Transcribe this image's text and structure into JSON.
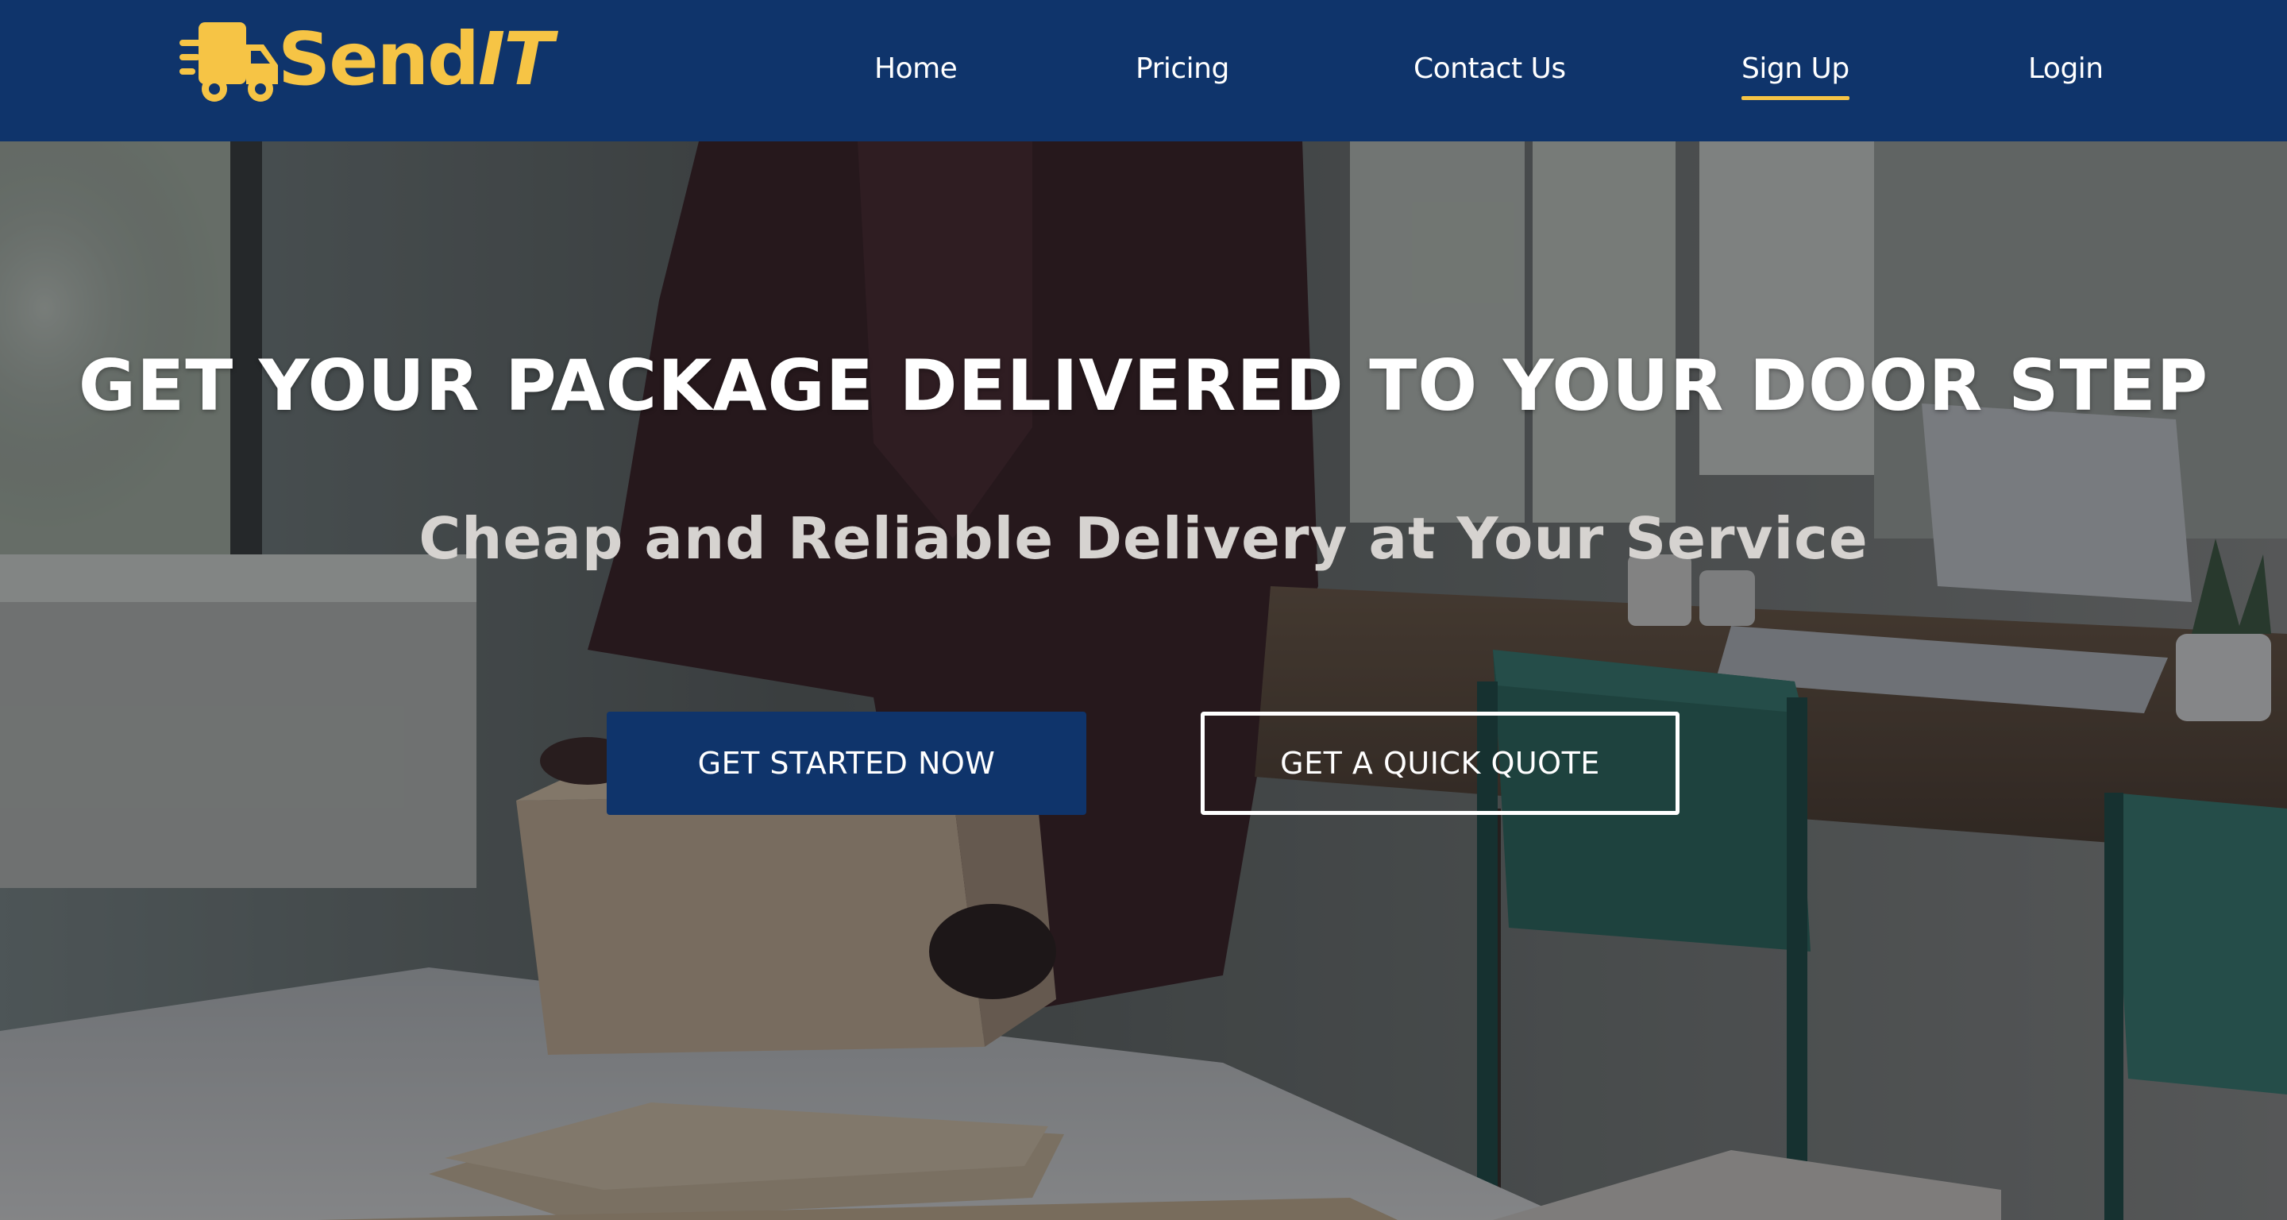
{
  "brand": {
    "name_main": "Send",
    "name_accent": "IT",
    "icon": "delivery-truck-icon",
    "color": "#f6c445"
  },
  "nav": {
    "background": "#0f346b",
    "items": [
      {
        "label": "Home"
      },
      {
        "label": "Pricing"
      },
      {
        "label": "Contact Us"
      },
      {
        "label": "Sign Up",
        "active": true
      },
      {
        "label": "Login"
      }
    ]
  },
  "hero": {
    "headline": "GET YOUR PACKAGE DELIVERED TO YOUR DOOR STEP",
    "subheadline": "Cheap and Reliable Delivery at Your Service",
    "primary_button": "GET STARTED NOW",
    "secondary_button": "GET A QUICK QUOTE"
  }
}
